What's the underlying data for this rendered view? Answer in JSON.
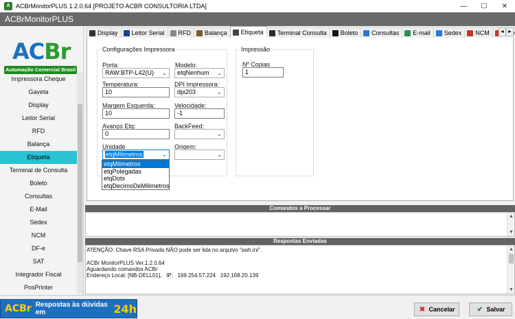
{
  "window": {
    "title": "ACBrMonitorPLUS 1.2.0.64  [PROJETO ACBR CONSULTORIA LTDA]",
    "minimize": "—",
    "maximize": "☐",
    "close": "✕"
  },
  "appbar": {
    "title": "ACBrMonitorPLUS"
  },
  "logo": {
    "brand_a": "AC",
    "brand_b": "Br",
    "tagline": "Automação Comercial Brasil"
  },
  "sidebar": {
    "items": [
      {
        "label": "Impressora Cheque"
      },
      {
        "label": "Gaveta"
      },
      {
        "label": "Display"
      },
      {
        "label": "Leitor Serial"
      },
      {
        "label": "RFD"
      },
      {
        "label": "Balança"
      },
      {
        "label": "Etiqueta",
        "active": true
      },
      {
        "label": "Terminal de Consulta"
      },
      {
        "label": "Boleto"
      },
      {
        "label": "Consultas"
      },
      {
        "label": "E-Mail"
      },
      {
        "label": "Sedex"
      },
      {
        "label": "NCM"
      },
      {
        "label": "DF-e"
      },
      {
        "label": "SAT"
      },
      {
        "label": "Integrador Fiscal"
      },
      {
        "label": "PosPrinter"
      }
    ]
  },
  "tabs": [
    {
      "label": "Display",
      "icon": "display-icon",
      "color": "#333333"
    },
    {
      "label": "Leitor Serial",
      "icon": "barcode-icon",
      "color": "#1f3f8f"
    },
    {
      "label": "RFD",
      "icon": "document-icon",
      "color": "#888888"
    },
    {
      "label": "Balança",
      "icon": "scale-icon",
      "color": "#7a5a2a"
    },
    {
      "label": "Etiqueta",
      "icon": "label-icon",
      "color": "#444444",
      "active": true
    },
    {
      "label": "Terminal Consulta",
      "icon": "terminal-icon",
      "color": "#2a2a2a"
    },
    {
      "label": "Boleto",
      "icon": "barcode-icon",
      "color": "#111111"
    },
    {
      "label": "Consultas",
      "icon": "globe-icon",
      "color": "#2a7ad0"
    },
    {
      "label": "E-mail",
      "icon": "email-icon",
      "color": "#2e8b57"
    },
    {
      "label": "Sedex",
      "icon": "globe-icon",
      "color": "#2a7ad0"
    },
    {
      "label": "NCM",
      "icon": "red-icon",
      "color": "#c0392b"
    },
    {
      "label": "DFe",
      "icon": "dfe-icon",
      "color": "#c0392b"
    }
  ],
  "tab_scroll": {
    "left": "◄",
    "right": "►"
  },
  "etiqueta": {
    "config_group": "Configurações Impressora",
    "impressao_group": "Impressão",
    "porta_label": "Porta:",
    "porta_value": "RAW:BTP-L42(U)",
    "modelo_label": "Modelo:",
    "modelo_value": "etqNenhum",
    "temperatura_label": "Temperatura:",
    "temperatura_value": "10",
    "dpi_label": "DPI Impressora:",
    "dpi_value": "dpi203",
    "margem_label": "Margem Esquerda:",
    "margem_value": "10",
    "velocidade_label": "Velocidade:",
    "velocidade_value": "-1",
    "avanco_label": "Avanço Etq:",
    "avanco_value": "0",
    "backfeed_label": "BackFeed:",
    "backfeed_value": "",
    "unidade_label": "Unidade",
    "unidade_value": "etqMilimetros",
    "origem_label": "Origem:",
    "origem_value": "",
    "copias_label": "Nº Copias",
    "copias_value": "1",
    "unidade_options": [
      "etqMilimetros",
      "etqPolegadas",
      "etqDots",
      "etqDecimoDeMilimetros"
    ]
  },
  "comandos": {
    "header": "Comandos a Processar"
  },
  "respostas": {
    "header": "Respostas Enviadas",
    "lines": [
      "ATENÇÃO: Chave RSA Privada NÃO pode ser lida no arquivo \"swh.ini\".",
      "",
      "ACBr MonitorPLUS Ver.1.2.0.64",
      "Aguardando comandos ACBr",
      "Endereço Local: [NB-DELL01],   IP:   169.254.57.224   192.168.20.139"
    ]
  },
  "footer": {
    "banner_text": "Respostas às dúvidas em",
    "banner_hours": "24h",
    "banner_brand": "ACBr",
    "cancel_label": "Cancelar",
    "save_label": "Salvar"
  },
  "colors": {
    "active_item": "#29c3d3",
    "header_gray": "#636363",
    "selection": "#0078d7"
  }
}
